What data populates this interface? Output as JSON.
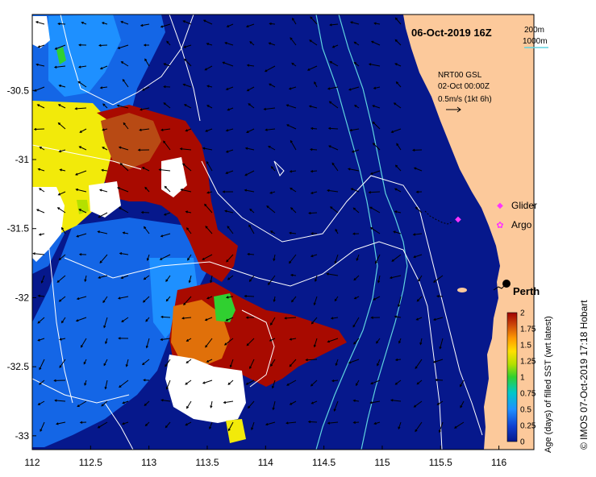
{
  "header": {
    "title": "06-Oct-2019 16Z",
    "depth_contour_1": "200m",
    "depth_contour_2": "1000m"
  },
  "current_info": {
    "line1": "NRT00 GSL",
    "line2": "02-Oct 00:00Z",
    "line3": "0.5m/s (1kt 6h)"
  },
  "legend": {
    "glider": "Glider",
    "argo": "Argo",
    "glider_color": "#ff33ff",
    "argo_color": "#ff33ff"
  },
  "place": {
    "perth": "Perth"
  },
  "axes": {
    "x_ticks": [
      "112",
      "112.5",
      "113",
      "113.5",
      "114",
      "114.5",
      "115",
      "115.5",
      "116"
    ],
    "x_values": [
      112,
      112.5,
      113,
      113.5,
      114,
      114.5,
      115,
      115.5,
      116
    ],
    "y_ticks": [
      "-30.5",
      "-31",
      "-31.5",
      "-32",
      "-32.5",
      "-33"
    ],
    "y_values": [
      -30.5,
      -31,
      -31.5,
      -32,
      -32.5,
      -33
    ],
    "xlim": [
      112,
      116.3
    ],
    "ylim": [
      -33.1,
      -29.95
    ]
  },
  "colorbar": {
    "label": "Age (days) of filled SST (wrt latest)",
    "ticks": [
      "0",
      "0.25",
      "0.5",
      "0.75",
      "1",
      "1.25",
      "1.5",
      "1.75",
      "2"
    ],
    "values": [
      0,
      0.25,
      0.5,
      0.75,
      1,
      1.25,
      1.5,
      1.75,
      2
    ],
    "range": [
      0,
      2
    ]
  },
  "credit": "© IMOS 07-Oct-2019 17:18 Hobart",
  "colors": {
    "land": "#fcc99b",
    "ocean_age0": "#06188c",
    "contour": "#ffffff",
    "isobath": "#5fd3e0"
  }
}
